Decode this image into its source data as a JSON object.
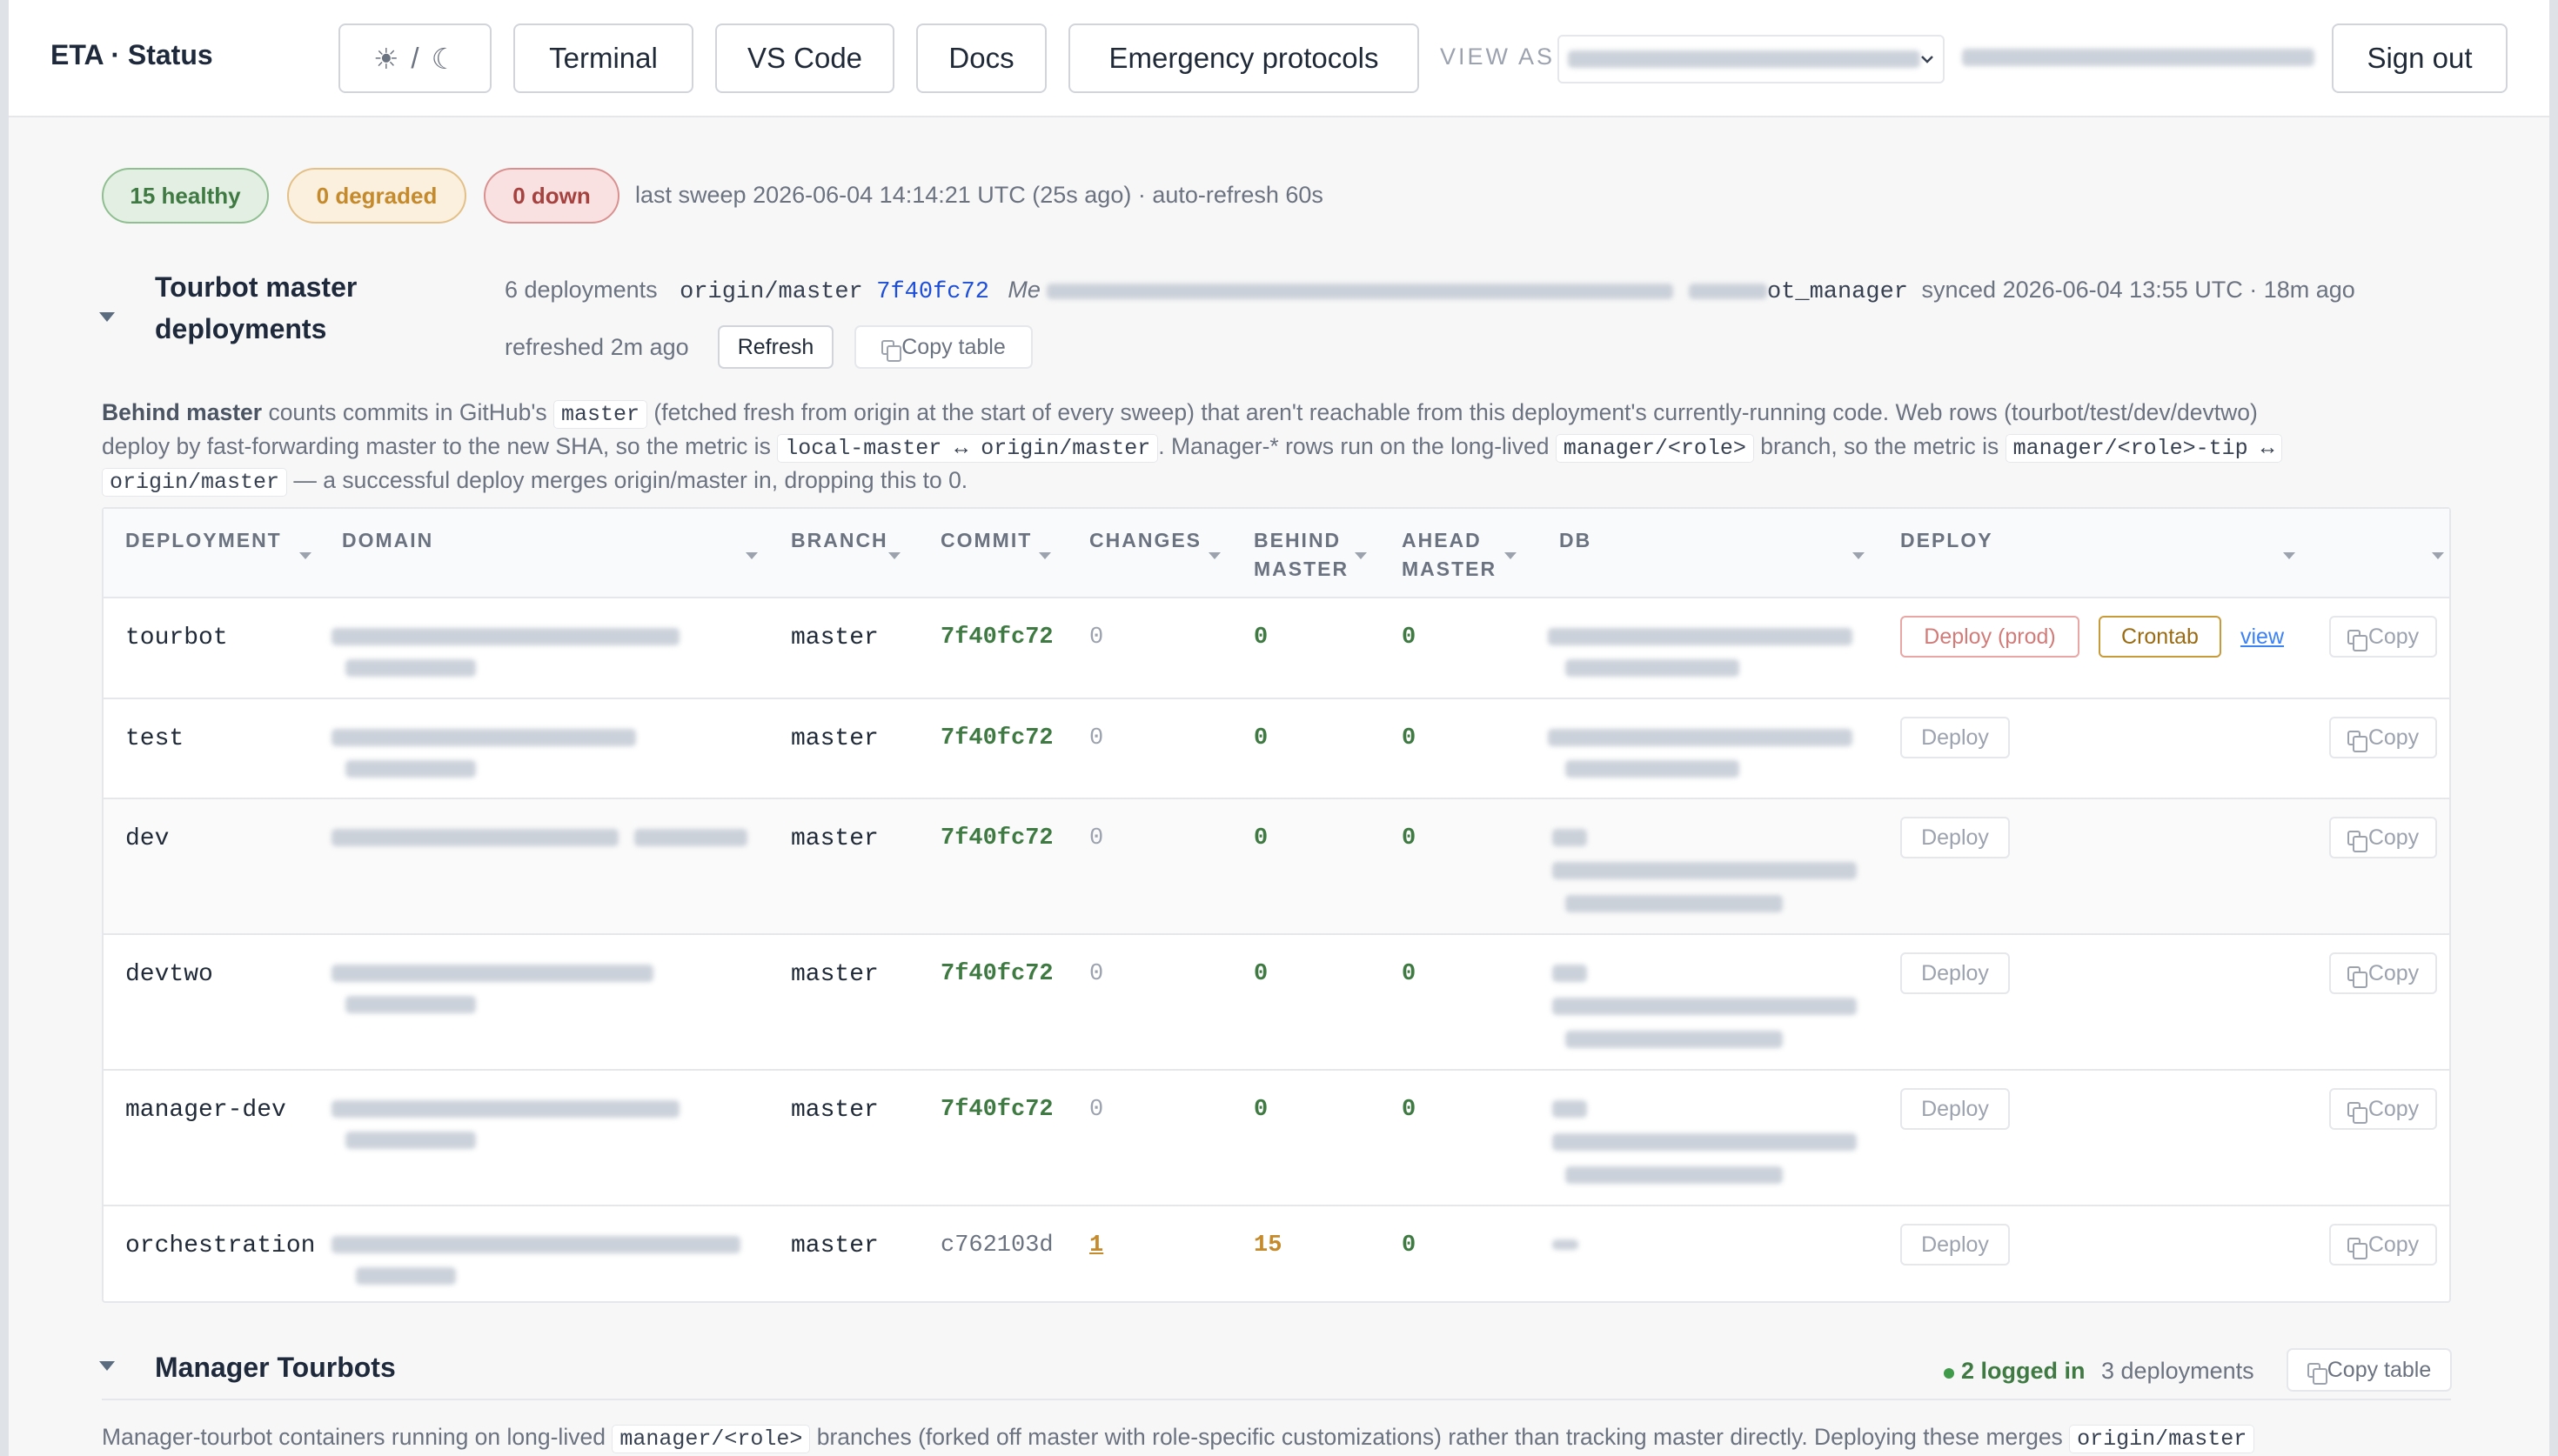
{
  "header": {
    "brand": "ETA · Status",
    "theme_toggle": {
      "sun": "☀",
      "sep": "/",
      "moon": "☾"
    },
    "buttons": {
      "terminal": "Terminal",
      "vscode": "VS Code",
      "docs": "Docs",
      "emergency": "Emergency protocols"
    },
    "view_as_label": "VIEW AS",
    "sign_out": "Sign out"
  },
  "summary": {
    "healthy": "15 healthy",
    "degraded": "0 degraded",
    "down": "0 down",
    "sweep_text": "last sweep 2026-06-04 14:14:21 UTC (25s ago) · auto-refresh 60s"
  },
  "master_section": {
    "title_line1": "Tourbot master",
    "title_line2": "deployments",
    "deployments_count": "6 deployments",
    "origin_label": "origin/master",
    "sha": "7f40fc72",
    "message_prefix": "Me",
    "author_suffix": "ot_manager",
    "synced": "synced 2026-06-04 13:55 UTC · 18m ago",
    "refreshed": "refreshed 2m ago",
    "refresh_btn": "Refresh",
    "copy_table_btn": "Copy table",
    "desc": {
      "bold": "Behind master",
      "p1": " counts commits in GitHub's ",
      "c1": "master",
      "p2": " (fetched fresh from origin at the start of every sweep) that aren't reachable from this deployment's currently-running code. Web rows (tourbot/test/dev/devtwo)",
      "p3": "deploy by fast-forwarding master to the new SHA, so the metric is ",
      "c2": "local-master ↔ origin/master",
      "p4": ". Manager-* rows run on the long-lived ",
      "c3": "manager/<role>",
      "p5": " branch, so the metric is ",
      "c4": "manager/<role>-tip ↔",
      "c5": "origin/master",
      "p6": " — a successful deploy merges origin/master in, dropping this to 0."
    },
    "columns": {
      "deployment": "DEPLOYMENT",
      "domain": "DOMAIN",
      "branch": "BRANCH",
      "commit": "COMMIT",
      "changes": "CHANGES",
      "behind_1": "BEHIND",
      "behind_2": "MASTER",
      "ahead_1": "AHEAD",
      "ahead_2": "MASTER",
      "db": "DB",
      "deploy": "DEPLOY"
    },
    "rows": [
      {
        "name": "tourbot",
        "branch": "master",
        "commit": "7f40fc72",
        "changes": "0",
        "behind": "0",
        "ahead": "0",
        "deploy": "Deploy (prod)",
        "crontab": "Crontab",
        "view": "view",
        "copy": "Copy"
      },
      {
        "name": "test",
        "branch": "master",
        "commit": "7f40fc72",
        "changes": "0",
        "behind": "0",
        "ahead": "0",
        "deploy": "Deploy",
        "copy": "Copy"
      },
      {
        "name": "dev",
        "branch": "master",
        "commit": "7f40fc72",
        "changes": "0",
        "behind": "0",
        "ahead": "0",
        "deploy": "Deploy",
        "copy": "Copy"
      },
      {
        "name": "devtwo",
        "branch": "master",
        "commit": "7f40fc72",
        "changes": "0",
        "behind": "0",
        "ahead": "0",
        "deploy": "Deploy",
        "copy": "Copy"
      },
      {
        "name": "manager-dev",
        "branch": "master",
        "commit": "7f40fc72",
        "changes": "0",
        "behind": "0",
        "ahead": "0",
        "deploy": "Deploy",
        "copy": "Copy"
      },
      {
        "name": "orchestration",
        "branch": "master",
        "commit": "c762103d",
        "changes": "1",
        "behind": "15",
        "ahead": "0",
        "deploy": "Deploy",
        "copy": "Copy"
      }
    ]
  },
  "manager_section": {
    "title": "Manager Tourbots",
    "logged_in": "2 logged in",
    "deployments_count": "3 deployments",
    "copy_table_btn": "Copy table",
    "desc_p1": "Manager-tourbot containers running on long-lived ",
    "desc_c1": "manager/<role>",
    "desc_p2": " branches (forked off master with role-specific customizations) rather than tracking master directly. Deploying these merges ",
    "desc_c2": "origin/master"
  },
  "colors": {
    "healthy": "#3f7a43",
    "degraded": "#c48a2c",
    "down": "#a5413f",
    "link": "#1d4ed8"
  }
}
